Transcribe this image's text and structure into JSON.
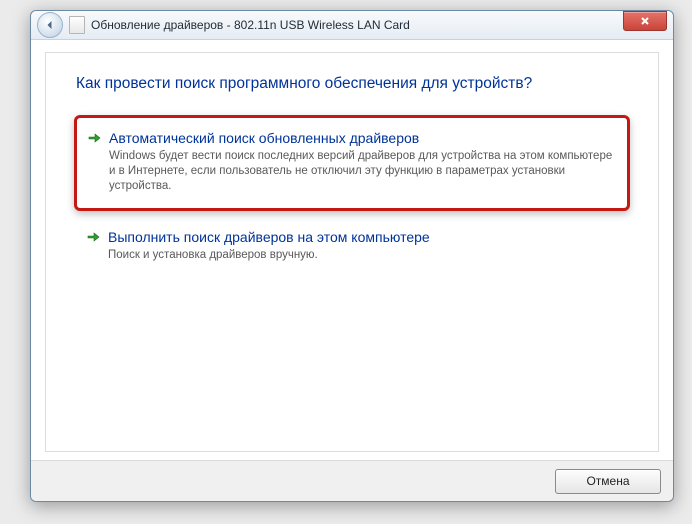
{
  "titlebar": {
    "text": "Обновление драйверов - 802.11n USB Wireless LAN Card"
  },
  "heading": "Как провести поиск программного обеспечения для устройств?",
  "options": {
    "auto": {
      "title": "Автоматический поиск обновленных драйверов",
      "desc": "Windows будет вести поиск последних версий драйверов для устройства на этом компьютере и в Интернете, если пользователь не отключил эту функцию в параметрах установки устройства."
    },
    "manual": {
      "title": "Выполнить поиск драйверов на этом компьютере",
      "desc": "Поиск и установка драйверов вручную."
    }
  },
  "buttons": {
    "cancel": "Отмена"
  }
}
